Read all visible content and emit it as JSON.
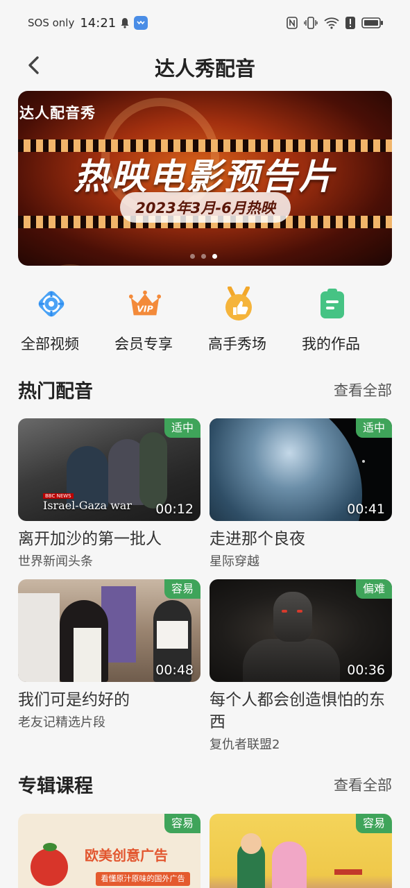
{
  "status_bar": {
    "carrier": "SOS only",
    "time": "14:21",
    "icons": [
      "bell-icon",
      "app-notification-icon",
      "nfc-icon",
      "vibrate-icon",
      "wifi-icon",
      "alert-icon",
      "battery-icon"
    ]
  },
  "header": {
    "back_icon": "chevron-left-icon",
    "title": "达人秀配音"
  },
  "banner": {
    "tag": "达人配音秀",
    "headline": "热映电影预告片",
    "date": "2023年3月-6月热映",
    "dots": 3,
    "active_dot": 3
  },
  "quick_nav": [
    {
      "label": "全部视频",
      "icon": "all-videos-icon",
      "color": "#2f8df0"
    },
    {
      "label": "会员专享",
      "icon": "vip-crown-icon",
      "color": "#f07d2a"
    },
    {
      "label": "高手秀场",
      "icon": "thumbs-up-medal-icon",
      "color": "#f2a72a"
    },
    {
      "label": "我的作品",
      "icon": "clipboard-icon",
      "color": "#3ec07a"
    }
  ],
  "hot_section": {
    "title": "热门配音",
    "more": "查看全部",
    "cards": [
      {
        "title": "离开加沙的第一批人",
        "subtitle": "世界新闻头条",
        "badge": "适中",
        "duration": "00:12",
        "caption": "Israel-Gaza war",
        "caption_logo": "BBC NEWS"
      },
      {
        "title": "走进那个良夜",
        "subtitle": "星际穿越",
        "badge": "适中",
        "duration": "00:41"
      },
      {
        "title": "我们可是约好的",
        "subtitle": "老友记精选片段",
        "badge": "容易",
        "duration": "00:48"
      },
      {
        "title": "每个人都会创造惧怕的东西",
        "subtitle": "复仇者联盟2",
        "badge": "偏难",
        "duration": "00:36"
      }
    ]
  },
  "course_section": {
    "title": "专辑课程",
    "more": "查看全部",
    "cards": [
      {
        "badge": "容易",
        "thumb_title": "欧美创意广告",
        "thumb_subtitle": "看懂原汁原味的国外广告"
      },
      {
        "badge": "容易"
      }
    ]
  },
  "colors": {
    "badge_green": "#3fa45a",
    "background": "#f6f6f6"
  }
}
